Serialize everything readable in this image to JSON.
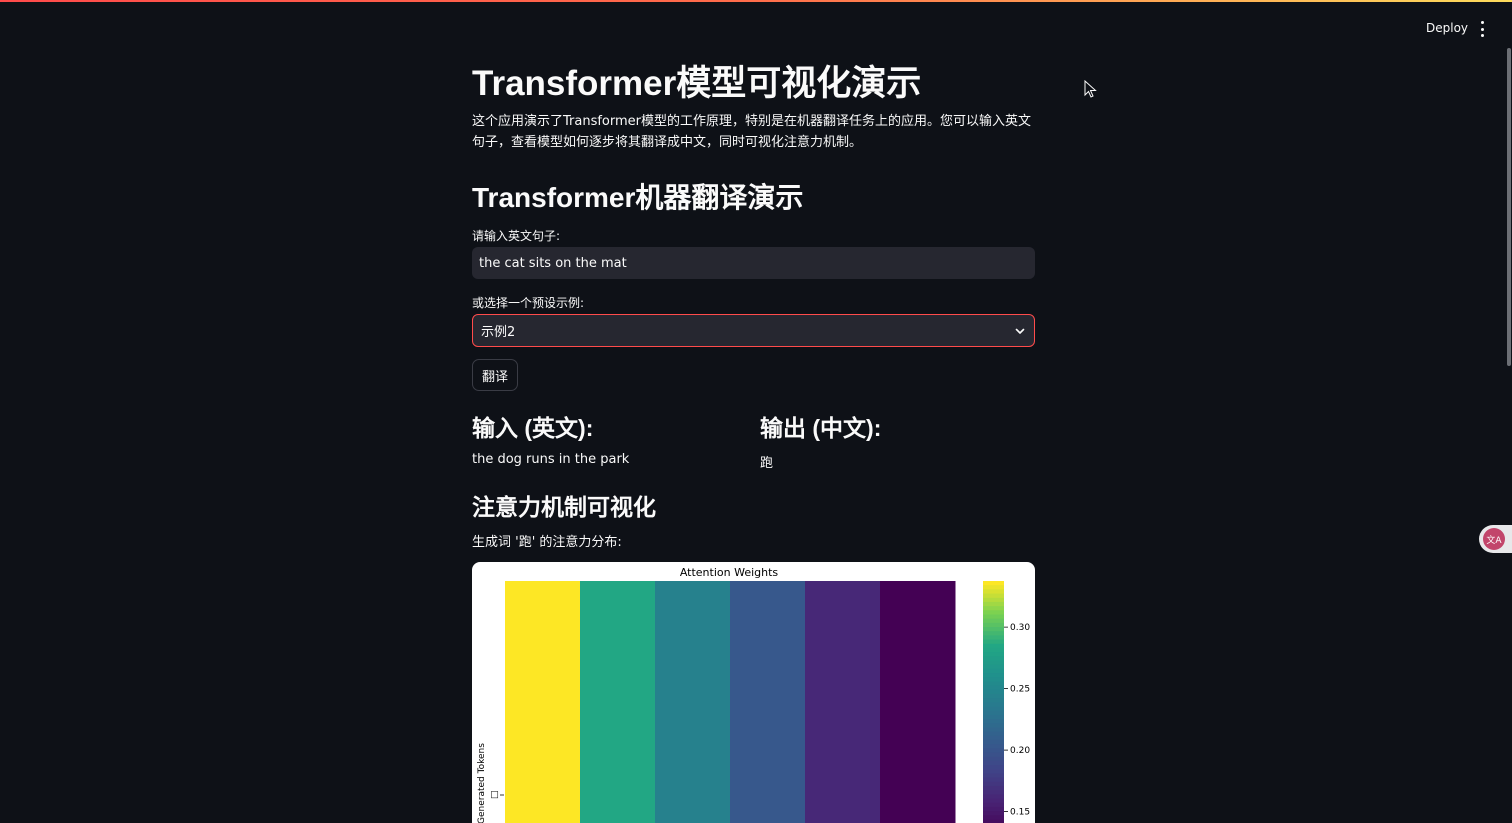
{
  "header": {
    "deploy_label": "Deploy",
    "menu_icon": "kebab-vertical-icon"
  },
  "main": {
    "title": "Transformer模型可视化演示",
    "intro": "这个应用演示了Transformer模型的工作原理，特别是在机器翻译任务上的应用。您可以输入英文句子，查看模型如何逐步将其翻译成中文，同时可视化注意力机制。",
    "section_title": "Transformer机器翻译演示",
    "input_label": "请输入英文句子:",
    "input_value": "the cat sits on the mat",
    "select_label": "或选择一个预设示例:",
    "select_value": "示例2",
    "translate_button": "翻译",
    "input_heading": "输入 (英文):",
    "input_text": "the dog runs in the park",
    "output_heading": "输出 (中文):",
    "output_text": "跑",
    "attention_heading": "注意力机制可视化",
    "attention_caption": "生成词 '跑' 的注意力分布:"
  },
  "colors": {
    "background": "#0e1117",
    "accent": "#ff4b4b",
    "input_bg": "#262730"
  },
  "chart_data": {
    "type": "heatmap",
    "title": "Attention Weights",
    "ylabel": "Generated Tokens",
    "y_tick_labels": [
      "□"
    ],
    "values": [
      [
        0.33,
        0.28,
        0.24,
        0.2,
        0.16,
        0.13
      ]
    ],
    "colormap": "viridis",
    "colorbar_range": [
      0.13,
      0.33
    ],
    "colorbar_ticks": [
      0.3,
      0.25,
      0.2,
      0.15
    ],
    "colorbar_tick_labels": [
      "0.30",
      "0.25",
      "0.20",
      "0.15"
    ]
  }
}
